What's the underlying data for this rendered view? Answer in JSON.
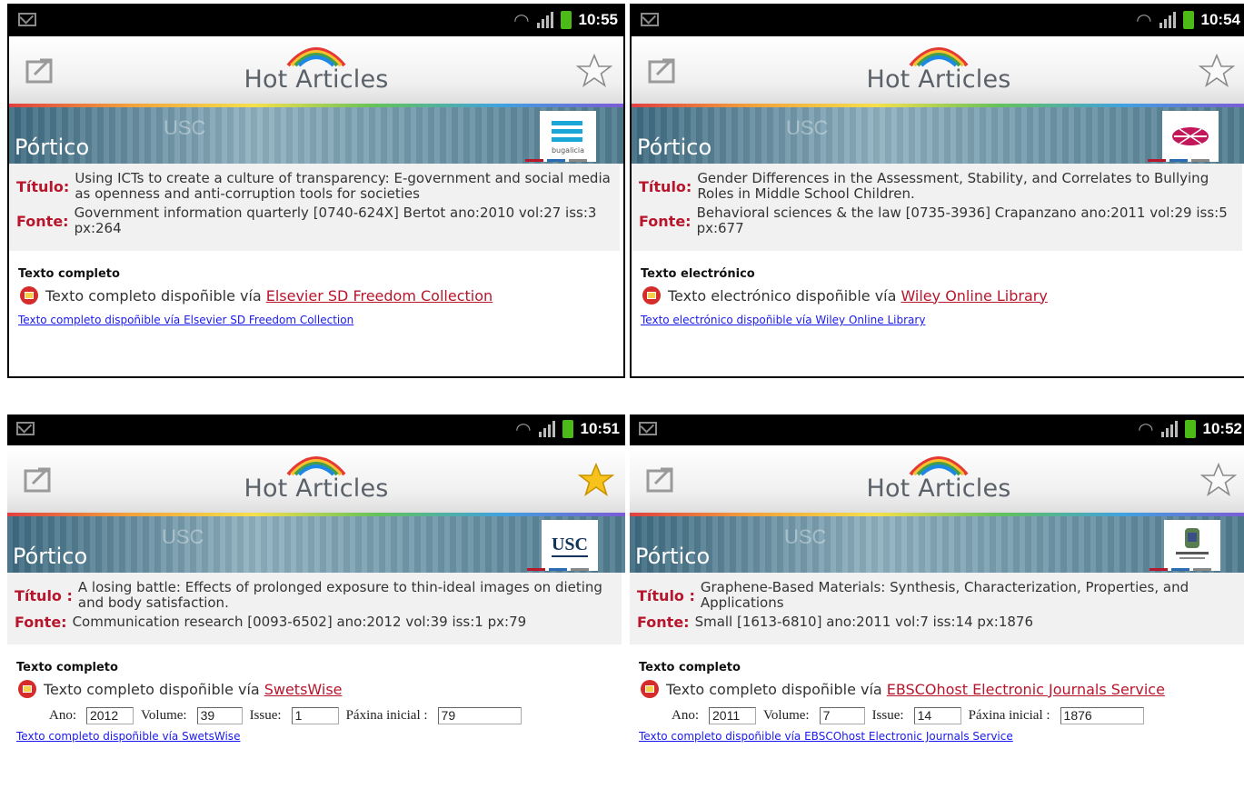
{
  "app_title": "Hot Articles",
  "banner_label": "Pórtico",
  "banner_watermark": "USC",
  "colors": {
    "accent_red": "#b8162c",
    "link_blue": "#1a1aee",
    "star_gold": "#f7c21b"
  },
  "screens": [
    {
      "time": "10:55",
      "starred": false,
      "logo": "bugalicia-logo",
      "title_label": "Título:",
      "title": "Using ICTs to create a culture of transparency: E-government and social media as openness and anti-corruption tools for societies",
      "source_label": "Fonte:",
      "source": "Government information quarterly [0740-624X] Bertot ano:2010 vol:27 iss:3 px:264",
      "section": "Texto completo",
      "availability": "Texto completo dispoñible vía",
      "provider": "Elsevier SD Freedom Collection",
      "link": "Texto completo dispoñible vía Elsevier SD Freedom Collection"
    },
    {
      "time": "10:54",
      "starred": false,
      "logo": "uvigo-logo",
      "title_label": "Título:",
      "title": "Gender Differences in the Assessment, Stability, and Correlates to Bullying Roles in Middle School Children.",
      "source_label": "Fonte:",
      "source": "Behavioral sciences & the law [0735-3936] Crapanzano ano:2011 vol:29 iss:5 px:677",
      "section": "Texto electrónico",
      "availability": "Texto electrónico dispoñible vía",
      "provider": "Wiley Online Library",
      "link": "Texto electrónico dispoñible vía Wiley  Online Library"
    },
    {
      "time": "10:51",
      "starred": true,
      "logo": "usc-logo",
      "title_label": "Título :",
      "title": "A losing battle: Effects of prolonged exposure to thin-ideal images on dieting and body satisfaction.",
      "source_label": "Fonte:",
      "source": "Communication research [0093-6502] ano:2012 vol:39 iss:1 px:79",
      "section": "Texto completo",
      "availability": "Texto completo dispoñible vía",
      "provider": "SwetsWise",
      "fields": {
        "ano_label": "Ano:",
        "ano": "2012",
        "volume_label": "Volume:",
        "volume": "39",
        "issue_label": "Issue:",
        "issue": "1",
        "paxina_label": "Páxina inicial :",
        "paxina": "79"
      },
      "link": "Texto completo dispoñible vía SwetsWise"
    },
    {
      "time": "10:52",
      "starred": false,
      "logo": "universidade-de-vigo-logo",
      "title_label": "Título :",
      "title": "Graphene-Based Materials: Synthesis, Characterization, Properties, and Applications",
      "source_label": "Fonte:",
      "source": "Small [1613-6810] ano:2011 vol:7 iss:14 px:1876",
      "section": "Texto completo",
      "availability": "Texto completo dispoñible vía",
      "provider": "EBSCOhost Electronic Journals Service",
      "fields": {
        "ano_label": "Ano:",
        "ano": "2011",
        "volume_label": "Volume:",
        "volume": "7",
        "issue_label": "Issue:",
        "issue": "14",
        "paxina_label": "Páxina inicial :",
        "paxina": "1876"
      },
      "link": "Texto completo dispoñible vía EBSCOhost Electronic Journals Service"
    }
  ]
}
